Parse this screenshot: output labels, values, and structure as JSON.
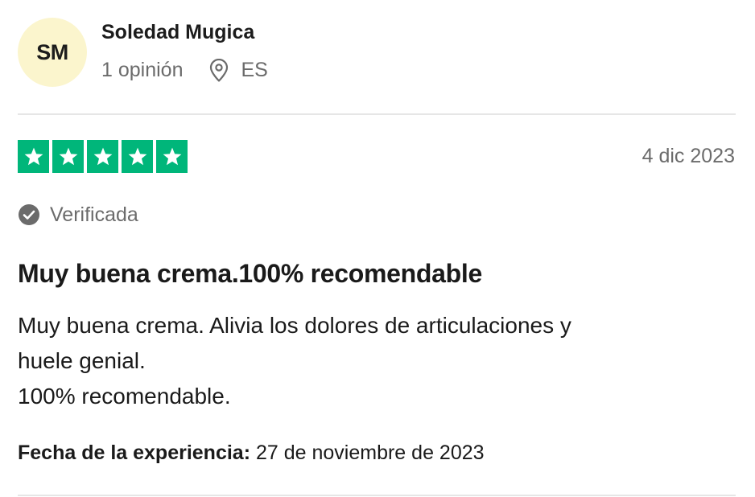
{
  "colors": {
    "star_green": "#00b67a",
    "avatar_bg": "#fbf5cd",
    "muted_text": "#6b6b6b",
    "divider": "#e6e6e6"
  },
  "reviewer": {
    "initials": "SM",
    "name": "Soledad Mugica",
    "review_count": "1 opinión",
    "location_icon": "map-pin-icon",
    "country": "ES"
  },
  "review": {
    "rating": 5,
    "rating_max": 5,
    "date": "4 dic 2023",
    "verified_icon": "check-circle-icon",
    "verified_label": "Verificada",
    "title": "Muy buena crema.100% recomendable",
    "body_lines": [
      "Muy buena crema. Alivia los dolores de articulaciones y",
      "huele genial.",
      "100% recomendable."
    ],
    "experience_label": "Fecha de la experiencia:",
    "experience_date": "27 de noviembre de 2023"
  }
}
